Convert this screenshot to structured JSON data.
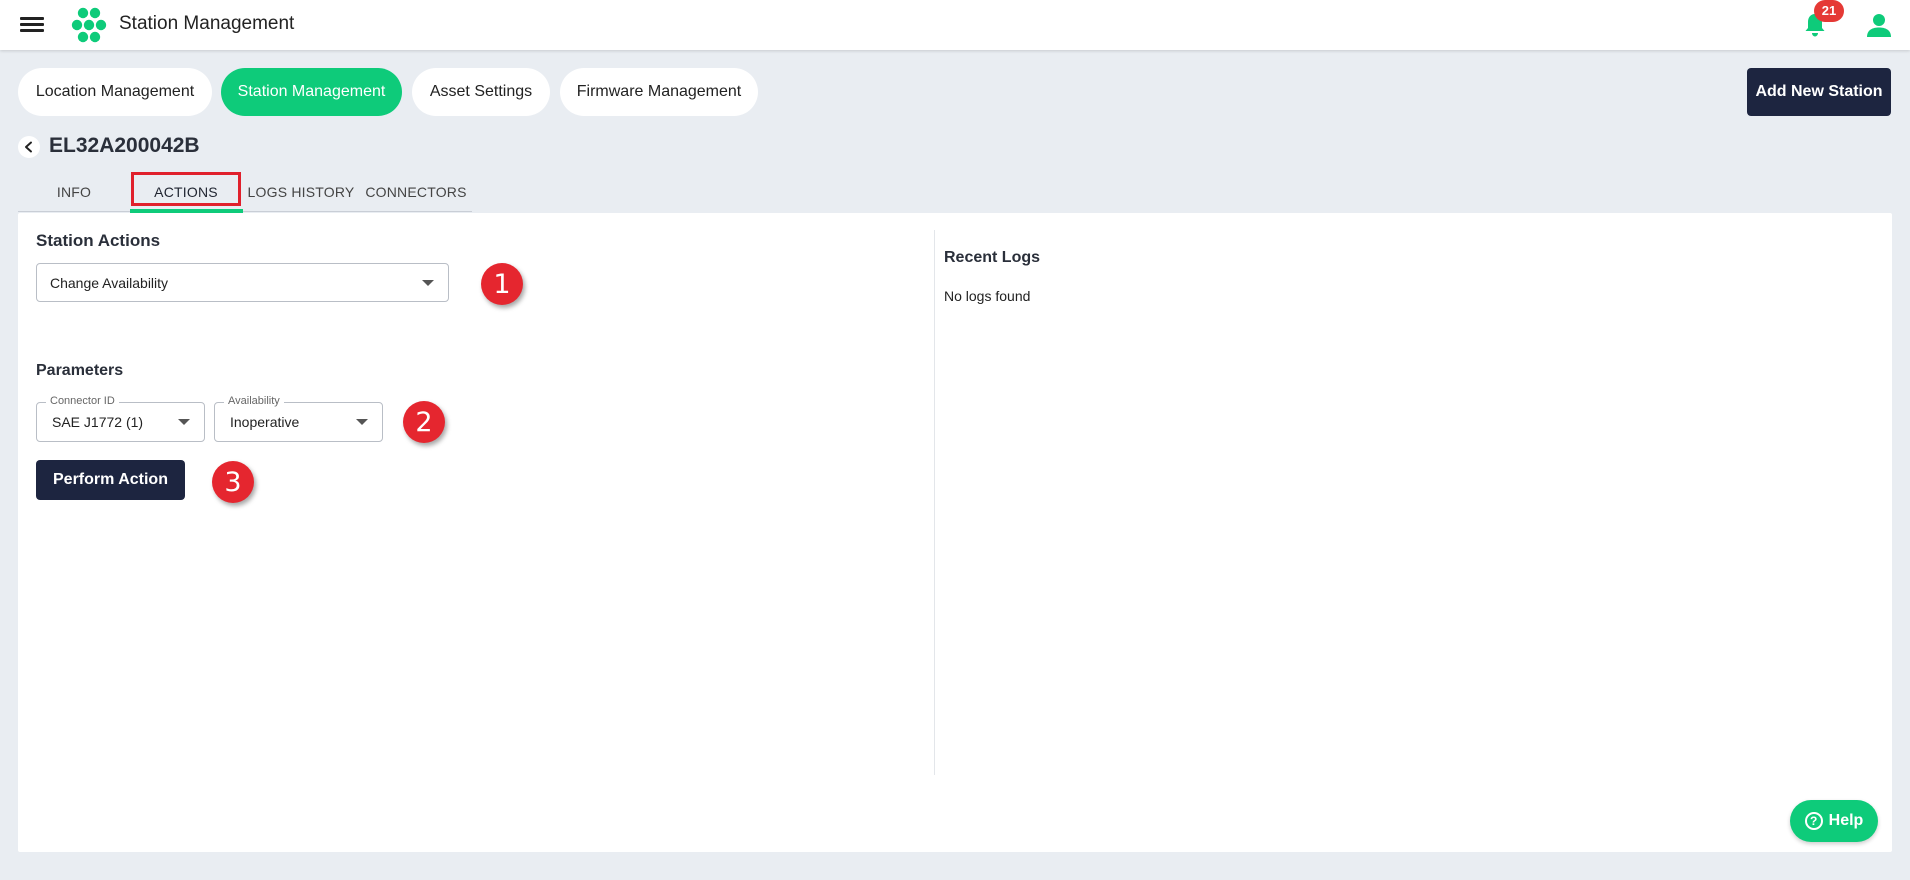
{
  "app": {
    "title": "Station Management",
    "notification_count": "21"
  },
  "nav": {
    "pills": [
      {
        "label": "Location Management",
        "active": false
      },
      {
        "label": "Station Management",
        "active": true
      },
      {
        "label": "Asset Settings",
        "active": false
      },
      {
        "label": "Firmware Management",
        "active": false
      }
    ],
    "add_station_label": "Add New Station"
  },
  "station": {
    "id": "EL32A200042B"
  },
  "tabs": [
    {
      "label": "INFO",
      "active": false
    },
    {
      "label": "ACTIONS",
      "active": true
    },
    {
      "label": "LOGS HISTORY",
      "active": false
    },
    {
      "label": "CONNECTORS",
      "active": false
    }
  ],
  "actions": {
    "title": "Station Actions",
    "selected_action": "Change Availability",
    "parameters_title": "Parameters",
    "connector_field": {
      "label": "Connector ID",
      "value": "SAE J1772 (1)"
    },
    "availability_field": {
      "label": "Availability",
      "value": "Inoperative"
    },
    "perform_label": "Perform Action"
  },
  "logs": {
    "title": "Recent Logs",
    "empty_text": "No logs found"
  },
  "annotations": [
    "1",
    "2",
    "3"
  ],
  "help_label": "Help",
  "colors": {
    "accent": "#0ecb7a",
    "dark": "#1d2540",
    "badge": "#e53935",
    "annotation": "#e5262f",
    "background": "#e9edf2"
  }
}
